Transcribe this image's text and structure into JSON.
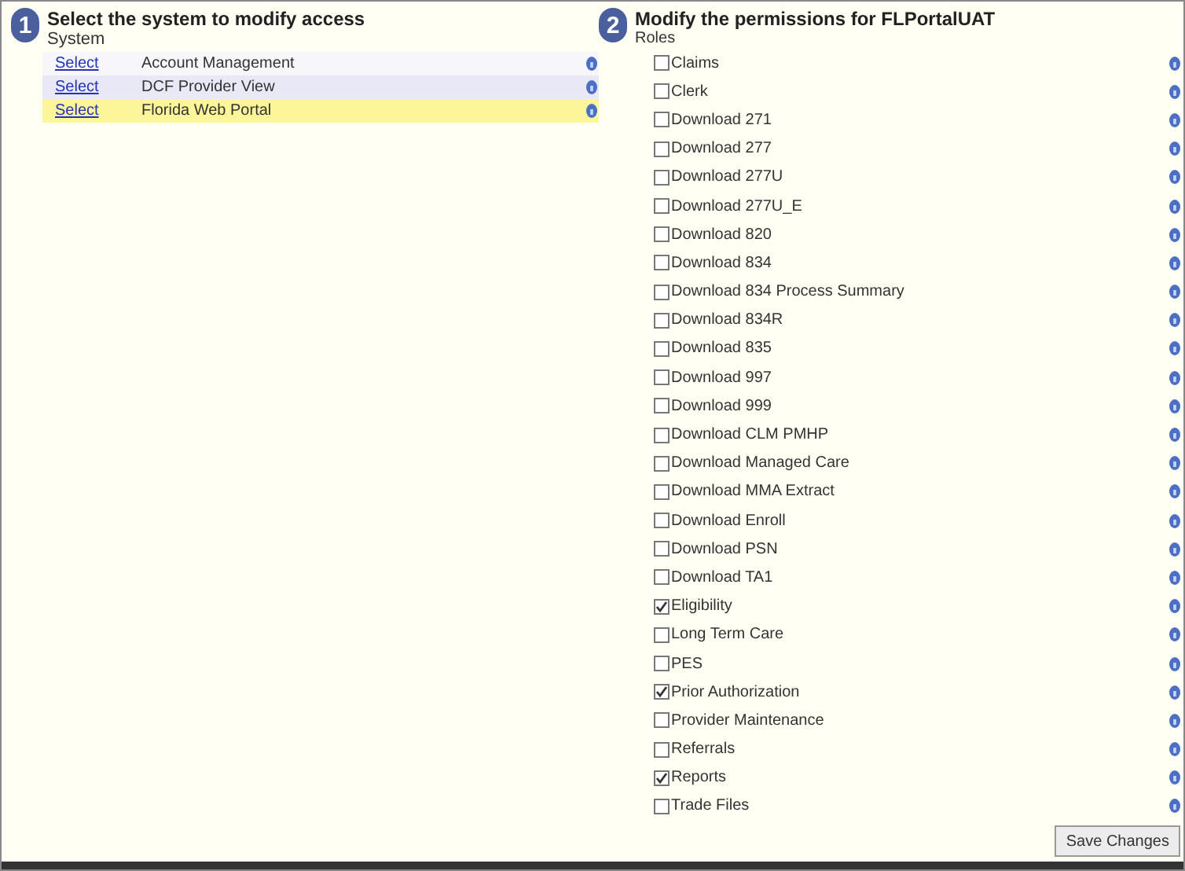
{
  "system_panel": {
    "step": "1",
    "title": "Select the system to modify access",
    "column_header": "System",
    "rows": [
      {
        "link": "Select",
        "name": "Account Management",
        "selected": false
      },
      {
        "link": "Select",
        "name": "DCF Provider View",
        "selected": false
      },
      {
        "link": "Select",
        "name": "Florida Web Portal",
        "selected": true
      }
    ]
  },
  "roles_panel": {
    "step": "2",
    "title": "Modify the permissions for FLPortalUAT",
    "column_header": "Roles",
    "roles": [
      {
        "label": "Claims",
        "checked": false
      },
      {
        "label": "Clerk",
        "checked": false
      },
      {
        "label": "Download 271",
        "checked": false
      },
      {
        "label": "Download 277",
        "checked": false
      },
      {
        "label": "Download 277U",
        "checked": false
      },
      {
        "label": "Download 277U_E",
        "checked": false
      },
      {
        "label": "Download 820",
        "checked": false
      },
      {
        "label": "Download 834",
        "checked": false
      },
      {
        "label": "Download 834 Process Summary",
        "checked": false
      },
      {
        "label": "Download 834R",
        "checked": false
      },
      {
        "label": "Download 835",
        "checked": false
      },
      {
        "label": "Download 997",
        "checked": false
      },
      {
        "label": "Download 999",
        "checked": false
      },
      {
        "label": "Download CLM PMHP",
        "checked": false
      },
      {
        "label": "Download Managed Care",
        "checked": false
      },
      {
        "label": "Download MMA Extract",
        "checked": false
      },
      {
        "label": "Download Enroll",
        "checked": false
      },
      {
        "label": "Download PSN",
        "checked": false
      },
      {
        "label": "Download TA1",
        "checked": false
      },
      {
        "label": "Eligibility",
        "checked": true
      },
      {
        "label": "Long Term Care",
        "checked": false
      },
      {
        "label": "PES",
        "checked": false
      },
      {
        "label": "Prior Authorization",
        "checked": true
      },
      {
        "label": "Provider Maintenance",
        "checked": false
      },
      {
        "label": "Referrals",
        "checked": false
      },
      {
        "label": "Reports",
        "checked": true
      },
      {
        "label": "Trade Files",
        "checked": false
      }
    ],
    "save_button": "Save Changes"
  }
}
